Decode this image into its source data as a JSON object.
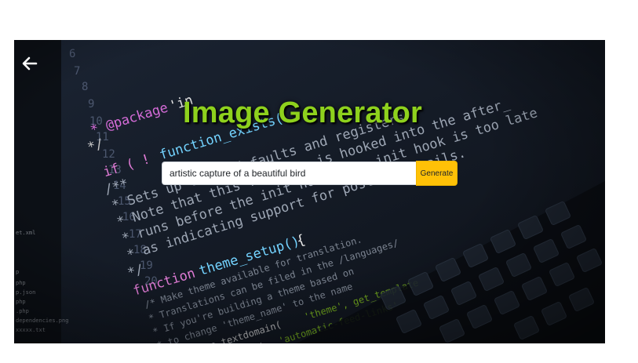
{
  "app": {
    "title": "Image Generator"
  },
  "nav": {
    "back_icon": "arrow-left-icon"
  },
  "prompt": {
    "value": "artistic capture of a beautiful bird",
    "placeholder": ""
  },
  "actions": {
    "generate_label": "Generate"
  },
  "colors": {
    "title": "#8ed11d",
    "button": "#ffc107",
    "page_background": "#ffffff"
  }
}
